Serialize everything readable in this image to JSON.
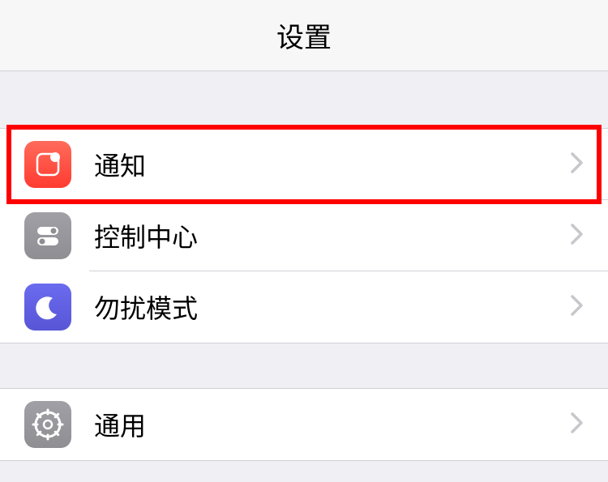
{
  "header": {
    "title": "设置"
  },
  "sections": {
    "notifications": {
      "label": "通知"
    },
    "control_center": {
      "label": "控制中心"
    },
    "do_not_disturb": {
      "label": "勿扰模式"
    },
    "general": {
      "label": "通用"
    }
  },
  "icons": {
    "notifications": "notifications-icon",
    "control_center": "toggle-icon",
    "do_not_disturb": "moon-icon",
    "general": "gear-icon",
    "chevron": "chevron-right-icon"
  },
  "highlight": {
    "target": "notifications"
  }
}
